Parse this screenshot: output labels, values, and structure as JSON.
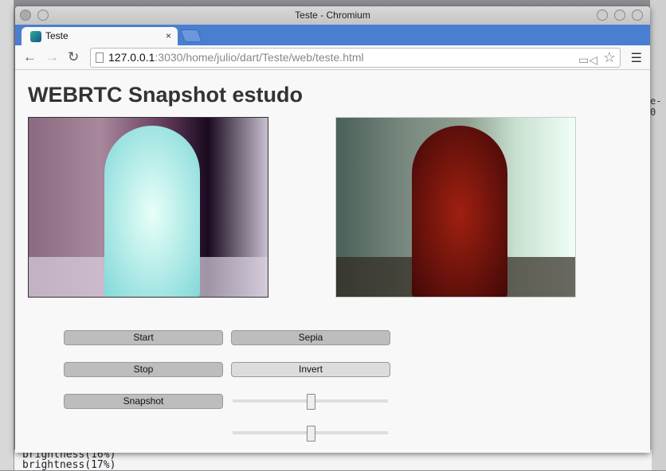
{
  "window": {
    "title": "Teste - Chromium"
  },
  "tab": {
    "label": "Teste",
    "close": "×"
  },
  "address": {
    "host": "127.0.0.1",
    "rest": ":3030/home/julio/dart/Teste/web/teste.html"
  },
  "page": {
    "heading": "WEBRTC Snapshot estudo"
  },
  "buttons": {
    "start": "Start",
    "stop": "Stop",
    "snapshot": "Snapshot",
    "sepia": "Sepia",
    "invert": "Invert"
  },
  "sliders": [
    {
      "value": 0.5
    },
    {
      "value": 0.5
    }
  ],
  "background": {
    "terminal_line1": "brightness(16%)",
    "terminal_line2": "brightness(17%)",
    "right_text": "e-0"
  }
}
